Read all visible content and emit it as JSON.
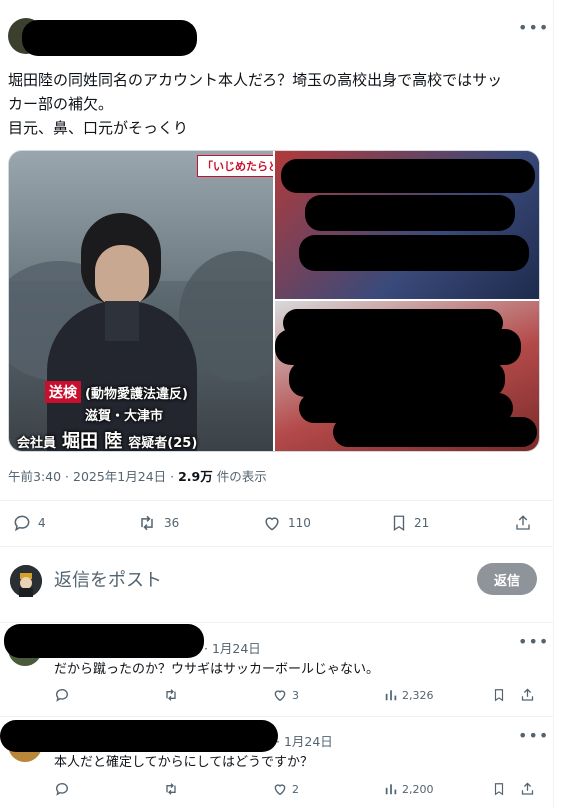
{
  "post": {
    "more_label": "•••",
    "text_line1": "堀田陸の同姓同名のアカウント本人だろ？埼玉の高校出身で高校ではサッ",
    "text_line2": "カー部の補欠。",
    "text_line3": "目元、鼻、口元がそっくり",
    "time": "午前3:40 · 2025年1月24日 ·",
    "views_count": "2.9万",
    "views_label": "件の表示",
    "media": {
      "news_tag": "「いじめたらど",
      "caption_tag": "送検",
      "caption_charge": "(動物愛護法違反)",
      "caption_location": "滋賀・大津市",
      "caption_role": "会社員",
      "caption_name": "堀田 陸",
      "caption_suffix": "容疑者(25)"
    },
    "stats": {
      "replies": "4",
      "reposts": "36",
      "likes": "110",
      "bookmarks": "21"
    }
  },
  "compose": {
    "placeholder": "返信をポスト",
    "button_label": "返信"
  },
  "replies": [
    {
      "date": "· 1月24日",
      "text": "だから蹴ったのか？ウサギはサッカーボールじゃない。",
      "likes": "3",
      "views": "2,326"
    },
    {
      "date": "· 1月24日",
      "text": "本人だと確定してからにしてはどうですか？",
      "likes": "2",
      "views": "2,200"
    }
  ],
  "colors": {
    "text_primary": "#0f1419",
    "text_secondary": "#536471",
    "reply_button": "#8e9499",
    "caption_red": "#c8102e"
  },
  "icons": [
    "reply-icon",
    "repost-icon",
    "like-icon",
    "bookmark-icon",
    "share-icon",
    "views-icon"
  ]
}
